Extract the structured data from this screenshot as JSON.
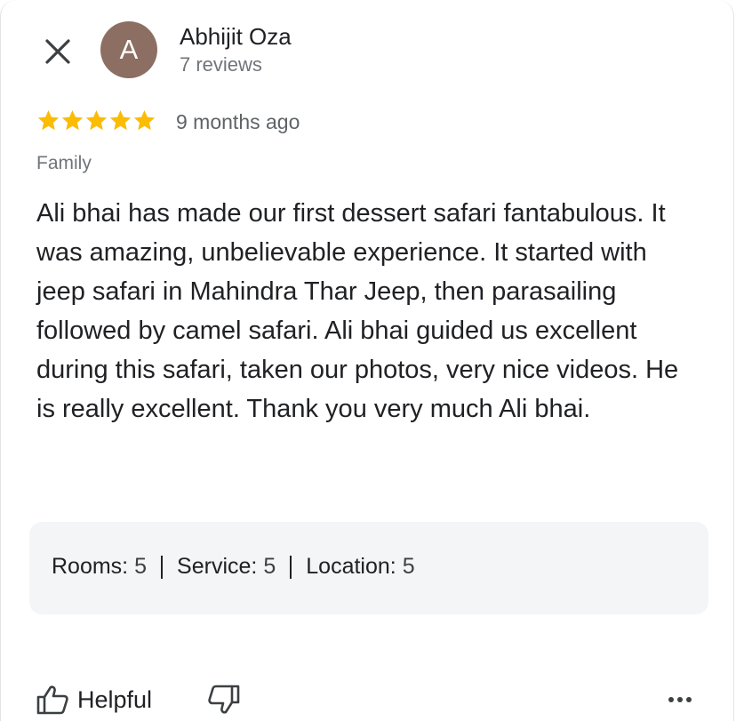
{
  "reviewer": {
    "avatar_initial": "A",
    "avatar_color": "#8d6e63",
    "name": "Abhijit Oza",
    "reviews_count": "7 reviews"
  },
  "review": {
    "rating": 5,
    "max_rating": 5,
    "star_color": "#fbbc04",
    "age": "9 months ago",
    "trip_type": "Family",
    "text": "Ali bhai has made our first dessert safari fantabulous. It was amazing, unbelievable experience. It started with jeep safari in Mahindra Thar Jeep, then parasailing followed by camel safari. Ali bhai guided us excellent during this safari, taken our photos, very nice videos. He is really excellent. Thank you very much Ali bhai."
  },
  "ratings": {
    "rooms_label": "Rooms:",
    "rooms_value": "5",
    "service_label": "Service:",
    "service_value": "5",
    "location_label": "Location:",
    "location_value": "5"
  },
  "actions": {
    "helpful_label": "Helpful",
    "close_icon": "close-icon",
    "thumbs_up_icon": "thumbs-up-icon",
    "thumbs_down_icon": "thumbs-down-icon",
    "more_icon": "more-horizontal-icon"
  }
}
